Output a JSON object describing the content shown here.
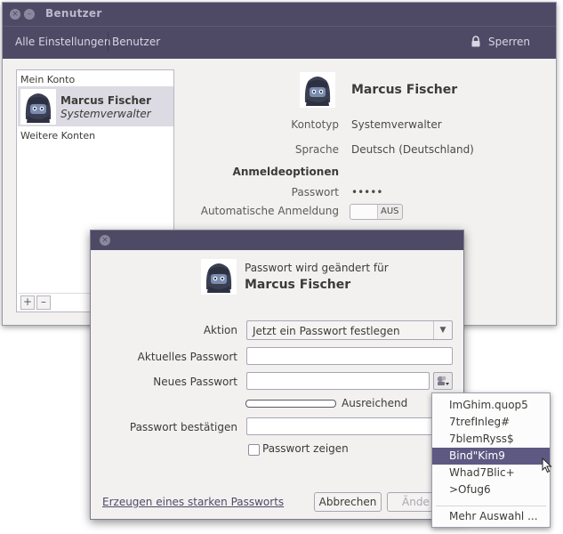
{
  "window": {
    "title": "Benutzer",
    "close_glyph": "×",
    "minimize_glyph": "–"
  },
  "toolbar": {
    "breadcrumb_all_settings": "Alle Einstellungen",
    "breadcrumb_users": "Benutzer",
    "lock_label": "Sperren",
    "lock_icon": "lock-icon"
  },
  "sidebar": {
    "my_account_label": "Mein Konto",
    "current_user": {
      "name": "Marcus Fischer",
      "role": "Systemverwalter"
    },
    "other_accounts_label": "Weitere Konten",
    "add_glyph": "+",
    "remove_glyph": "–"
  },
  "details": {
    "name": "Marcus Fischer",
    "account_type_label": "Kontotyp",
    "account_type_value": "Systemverwalter",
    "language_label": "Sprache",
    "language_value": "Deutsch (Deutschland)",
    "login_options_heading": "Anmeldeoptionen",
    "password_label": "Passwort",
    "password_value": "•••••",
    "auto_login_label": "Automatische Anmeldung",
    "auto_login_state": "AUS",
    "auto_login_on": false
  },
  "dialog": {
    "close_glyph": "×",
    "header_text": "Passwort wird geändert für",
    "user_name": "Marcus Fischer",
    "action_label": "Aktion",
    "action_value": "Jetzt ein Passwort festlegen",
    "current_password_label": "Aktuelles Passwort",
    "new_password_label": "Neues Passwort",
    "strength_text": "Ausreichend",
    "confirm_password_label": "Passwort bestätigen",
    "show_password_label": "Passwort zeigen",
    "show_password_checked": false,
    "generate_link": "Erzeugen eines starken Passworts",
    "cancel_button": "Abbrechen",
    "change_button": "Ände"
  },
  "popup": {
    "suggestions": [
      "ImGhim.quop5",
      "7trefInleg#",
      "7blemRyss$",
      "Bind\"Kim9",
      "Whad7Blic+",
      ">Ofug6"
    ],
    "selected_index": 3,
    "more_label": "Mehr Auswahl ..."
  },
  "colors": {
    "titlebar": "#4e4a66",
    "selection": "#5d5983",
    "window_bg": "#f2f1f0"
  }
}
